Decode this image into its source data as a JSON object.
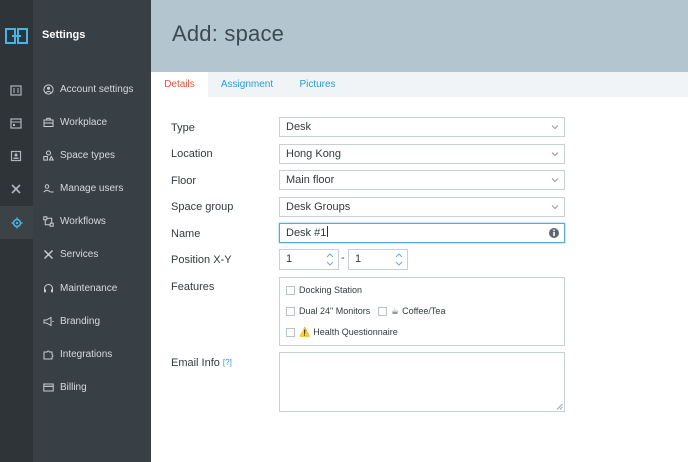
{
  "colors": {
    "rail": "#2f3438",
    "sidebar": "#394045",
    "header": "#b3c6cf",
    "accent": "#2a9cd4",
    "active_tab": "#e2533f"
  },
  "rail": {
    "icons": [
      "logo-icon",
      "building-icon",
      "calendar-icon",
      "badge-icon",
      "tools-icon",
      "gear-icon"
    ],
    "active": "gear-icon"
  },
  "sidebar": {
    "title": "Settings",
    "items": [
      {
        "label": "Account settings",
        "icon": "user-circle-icon"
      },
      {
        "label": "Workplace",
        "icon": "briefcase-icon"
      },
      {
        "label": "Space types",
        "icon": "shapes-icon"
      },
      {
        "label": "Manage users",
        "icon": "users-icon"
      },
      {
        "label": "Workflows",
        "icon": "workflow-icon"
      },
      {
        "label": "Services",
        "icon": "tools-icon"
      },
      {
        "label": "Maintenance",
        "icon": "headset-icon"
      },
      {
        "label": "Branding",
        "icon": "megaphone-icon"
      },
      {
        "label": "Integrations",
        "icon": "puzzle-icon"
      },
      {
        "label": "Billing",
        "icon": "credit-card-icon"
      }
    ]
  },
  "header": {
    "title": "Add: space"
  },
  "tabs": [
    {
      "label": "Details",
      "active": true
    },
    {
      "label": "Assignment",
      "active": false
    },
    {
      "label": "Pictures",
      "active": false
    }
  ],
  "form": {
    "type": {
      "label": "Type",
      "value": "Desk"
    },
    "location": {
      "label": "Location",
      "value": "Hong Kong"
    },
    "floor": {
      "label": "Floor",
      "value": "Main floor"
    },
    "space_group": {
      "label": "Space group",
      "value": "Desk Groups"
    },
    "name": {
      "label": "Name",
      "value": "Desk #1"
    },
    "position": {
      "label": "Position X-Y",
      "x": "1",
      "separator": "-",
      "y": "1"
    },
    "features": {
      "label": "Features",
      "options": [
        {
          "label": "Docking Station",
          "emoji": "",
          "checked": false
        },
        {
          "label": "Dual 24\" Monitors",
          "emoji": "",
          "checked": false
        },
        {
          "label": "Coffee/Tea",
          "emoji": "☕",
          "checked": false
        },
        {
          "label": "Health Questionnaire",
          "emoji": "⚠️",
          "checked": false
        }
      ]
    },
    "email_info": {
      "label": "Email Info",
      "help": "[?]",
      "value": ""
    }
  }
}
